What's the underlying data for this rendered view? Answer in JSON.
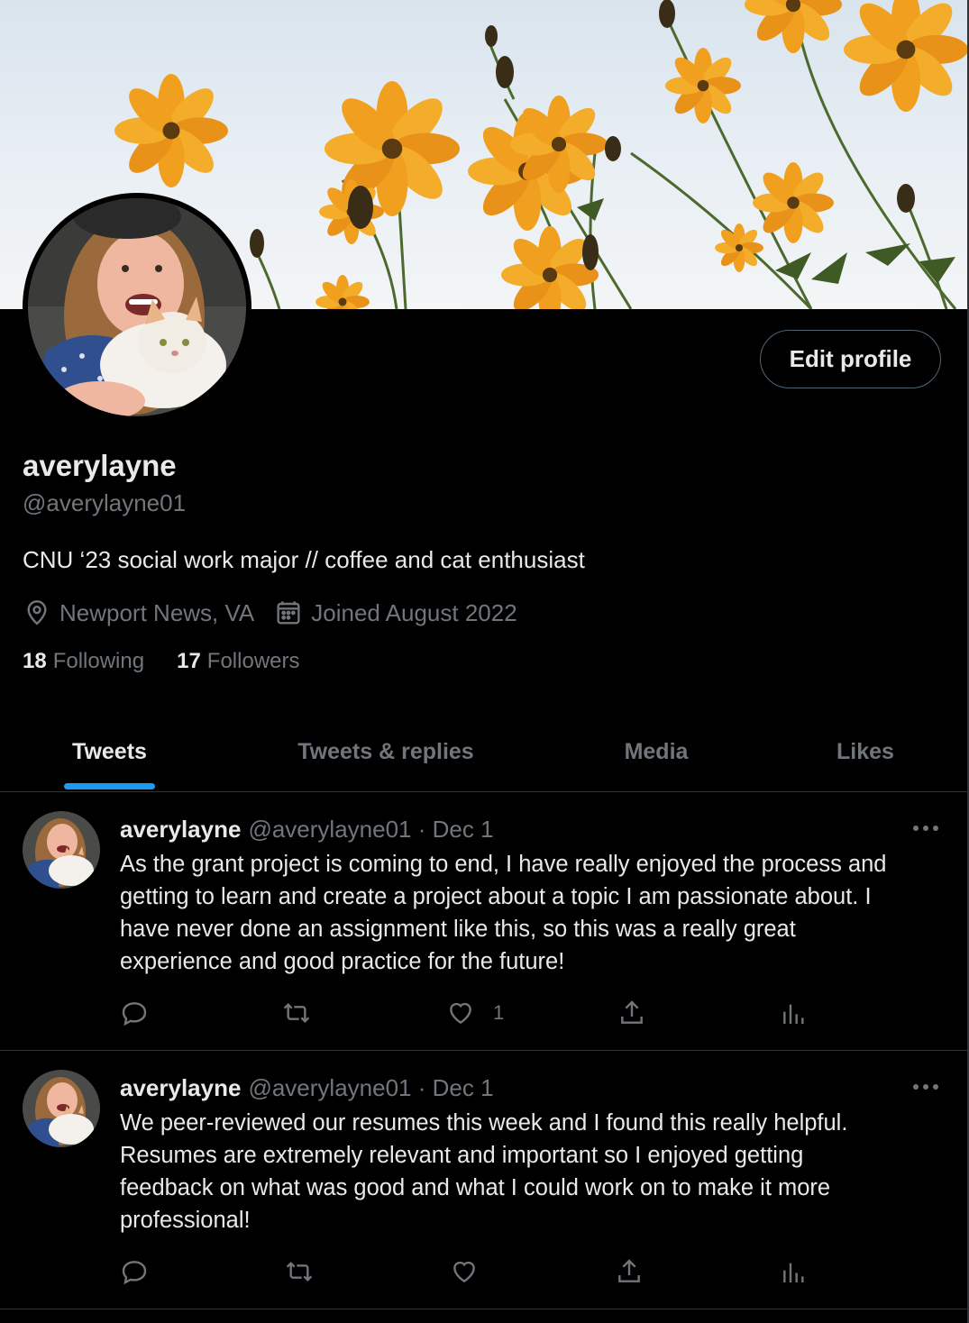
{
  "profile": {
    "display_name": "averylayne",
    "handle": "@averylayne01",
    "bio": "CNU ‘23 social work major // coffee and cat enthusiast",
    "location": "Newport News, VA",
    "joined": "Joined August 2022",
    "following_count": "18",
    "following_label": "Following",
    "followers_count": "17",
    "followers_label": "Followers",
    "edit_label": "Edit profile"
  },
  "tabs": [
    {
      "label": "Tweets",
      "active": true
    },
    {
      "label": "Tweets & replies"
    },
    {
      "label": "Media"
    },
    {
      "label": "Likes"
    }
  ],
  "tweets": [
    {
      "name": "averylayne",
      "meta": "@averylayne01 · Dec 1",
      "text": "As the grant project is coming to end, I have really enjoyed the process and\ngetting to learn and create a project about a topic I am passionate about. I\nhave never done an assignment like this, so this was a really great\nexperience and good practice for the future!",
      "likes": "1"
    },
    {
      "name": "averylayne",
      "meta": "@averylayne01 · Dec 1",
      "text": "We peer-reviewed our resumes this week and I found this really helpful.\nResumes are extremely relevant and important so I enjoyed getting\nfeedback on what was good and what I could work on to make it more\nprofessional!",
      "likes": ""
    }
  ],
  "icons": {
    "location": "map-pin-icon",
    "calendar": "calendar-icon",
    "reply": "reply-icon",
    "retweet": "retweet-icon",
    "like": "heart-icon",
    "share": "share-icon",
    "analytics": "analytics-icon",
    "more": "more-icon"
  },
  "colors": {
    "background": "#000000",
    "accent": "#1d9bf0",
    "text_primary": "#e7e9ea",
    "text_secondary": "#71767b",
    "border": "#2f3336"
  }
}
